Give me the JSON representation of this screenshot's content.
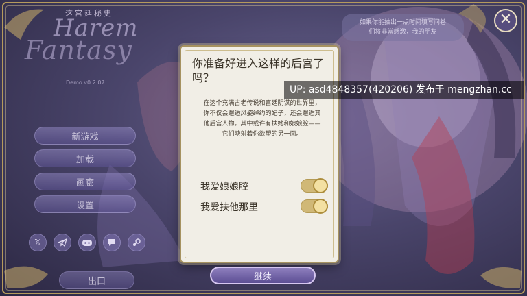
{
  "logo": {
    "small_text": "这宫廷秘史",
    "line1": "Harem",
    "line2": "Fantasy"
  },
  "version": "Demo v0.2.07",
  "main_menu": {
    "new_game": "新游戏",
    "load": "加载",
    "gallery": "画廊",
    "settings": "设置",
    "exit": "出口"
  },
  "social_icons": [
    "x-icon",
    "telegram-icon",
    "discord-icon",
    "chat-icon",
    "steam-icon"
  ],
  "speech_bubble": {
    "line1": "如果你能抽出一点时间填写问卷",
    "line2": "们将非常感激，我的朋友"
  },
  "watermark": "UP: asd4848357(420206) 发布于 mengzhan.cc",
  "dialog": {
    "title": "你准备好进入这样的后宫了吗？",
    "description": "在这个充满古老传说和宫廷阴谋的世界里，你不仅会邂逅风姿绰约的妃子，还会邂逅其他后宫人物。其中或许有扶她和娘娘腔——它们映射着你欲望的另一面。",
    "options": [
      {
        "label": "我爱娘娘腔",
        "enabled": true
      },
      {
        "label": "我爱扶他那里",
        "enabled": true
      }
    ]
  },
  "continue_label": "继续",
  "close_glyph": "✕",
  "colors": {
    "accent_gold": "#b59a5c",
    "dialog_bg": "#f1eee6",
    "button_purple": "#6f60a6"
  }
}
